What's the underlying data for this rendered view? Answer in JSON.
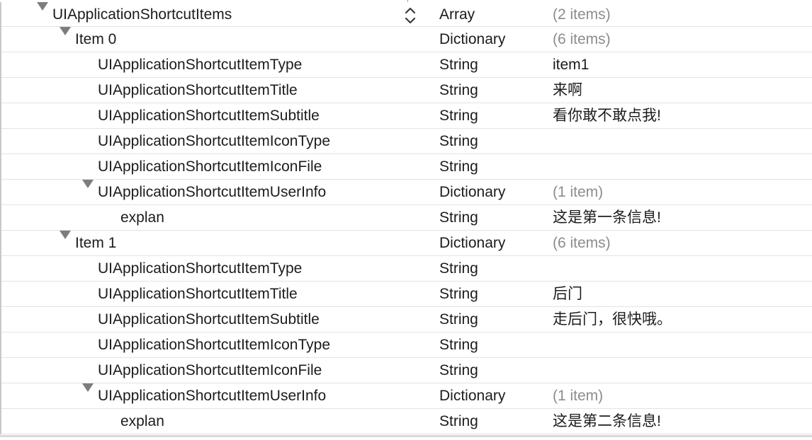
{
  "plist": {
    "root": {
      "key": "UIApplicationShortcutItems",
      "type": "Array",
      "value": "(2 items)"
    },
    "rows": [
      {
        "key": "Item 0",
        "type": "Dictionary",
        "value": "(6 items)"
      },
      {
        "key": "UIApplicationShortcutItemType",
        "type": "String",
        "value": "item1"
      },
      {
        "key": "UIApplicationShortcutItemTitle",
        "type": "String",
        "value": "来啊"
      },
      {
        "key": "UIApplicationShortcutItemSubtitle",
        "type": "String",
        "value": "看你敢不敢点我!"
      },
      {
        "key": "UIApplicationShortcutItemIconType",
        "type": "String",
        "value": ""
      },
      {
        "key": "UIApplicationShortcutItemIconFile",
        "type": "String",
        "value": ""
      },
      {
        "key": "UIApplicationShortcutItemUserInfo",
        "type": "Dictionary",
        "value": "(1 item)"
      },
      {
        "key": "explan",
        "type": "String",
        "value": "这是第一条信息!"
      },
      {
        "key": "Item 1",
        "type": "Dictionary",
        "value": "(6 items)"
      },
      {
        "key": "UIApplicationShortcutItemType",
        "type": "String",
        "value": ""
      },
      {
        "key": "UIApplicationShortcutItemTitle",
        "type": "String",
        "value": "后门"
      },
      {
        "key": "UIApplicationShortcutItemSubtitle",
        "type": "String",
        "value": "走后门，很快哦。"
      },
      {
        "key": "UIApplicationShortcutItemIconType",
        "type": "String",
        "value": ""
      },
      {
        "key": "UIApplicationShortcutItemIconFile",
        "type": "String",
        "value": ""
      },
      {
        "key": "UIApplicationShortcutItemUserInfo",
        "type": "Dictionary",
        "value": "(1 item)"
      },
      {
        "key": "explan",
        "type": "String",
        "value": "这是第二条信息!"
      }
    ]
  }
}
